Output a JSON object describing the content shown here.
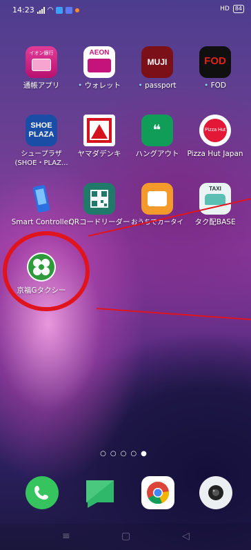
{
  "status_bar": {
    "time": "14:23",
    "battery": "84"
  },
  "apps": [
    {
      "name": "通帳アプリ",
      "icon_text": "イオン銀行"
    },
    {
      "name": "ウォレット",
      "icon_text": "AEON"
    },
    {
      "name": "passport",
      "icon_text": "MUJI"
    },
    {
      "name": "FOD",
      "icon_text": "FOD"
    },
    {
      "name": "シュープラザ (SHOE・PLAZ...",
      "icon_text": "SHOE PLAZA"
    },
    {
      "name": "ヤマダデンキ",
      "icon_text": ""
    },
    {
      "name": "ハングアウト",
      "icon_text": "99"
    },
    {
      "name": "Pizza Hut Japan",
      "icon_text": "Pizza Hut"
    },
    {
      "name": "Smart Controller",
      "icon_text": ""
    },
    {
      "name": "QRコードリーダー",
      "icon_text": ""
    },
    {
      "name": "おうちでカータイ",
      "icon_text": ""
    },
    {
      "name": "タク配BASE",
      "icon_text": "TAXI"
    },
    {
      "name": "京福Gタクシー",
      "icon_text": ""
    }
  ],
  "page_indicator": "○○○○●",
  "dock": [
    "phone-app",
    "messages-app",
    "chrome-app",
    "camera-app"
  ],
  "colors": {
    "annotation_red": "#e0141e",
    "aeon_pink": "#c4137a",
    "muji_red": "#7b1018",
    "fod_red": "#e2231a",
    "shoe_blue": "#1a4ea6",
    "yamada_red": "#d6131c",
    "hangouts_green": "#0f9d58",
    "keifuku_green": "#2e9a3c",
    "phone_green": "#35c45e"
  }
}
